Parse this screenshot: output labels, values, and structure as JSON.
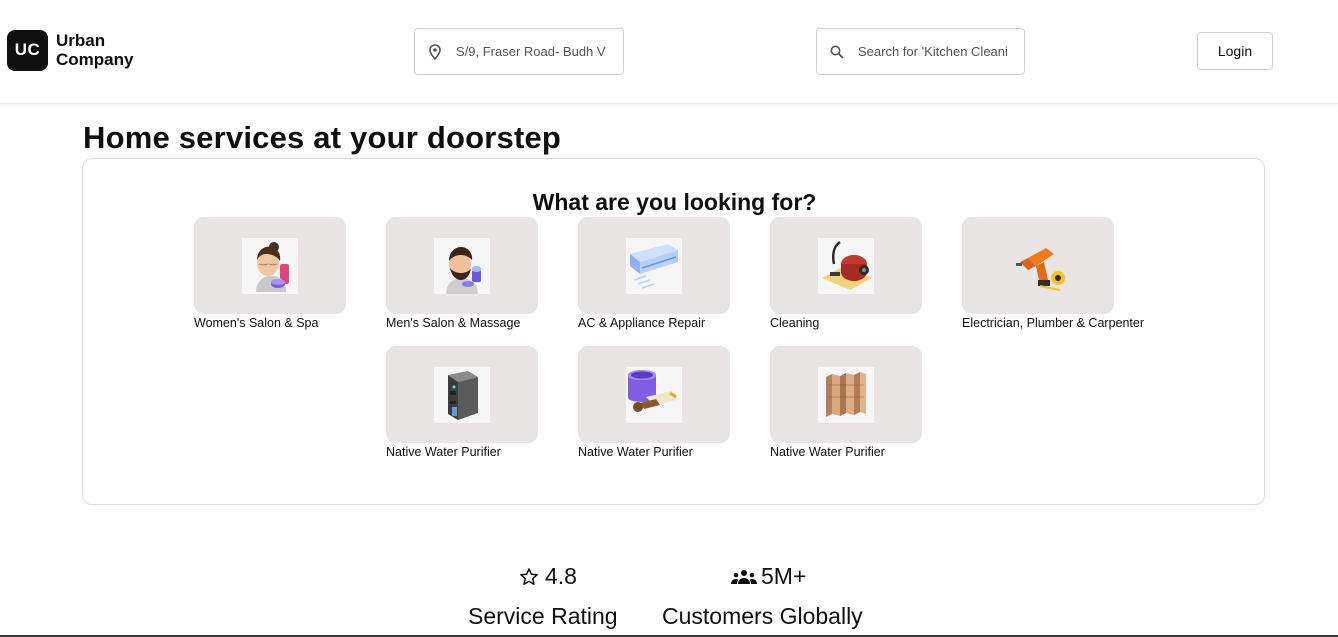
{
  "brand": {
    "mark": "UC",
    "line1": "Urban",
    "line2": "Company"
  },
  "header": {
    "location_value": "S/9, Fraser Road- Budh V",
    "search_placeholder": "Search for 'Kitchen Cleani",
    "login_label": "Login"
  },
  "main": {
    "title": "Home services at your doorstep",
    "panel_title": "What are you looking for?",
    "categories": [
      {
        "label": "Women's Salon & Spa",
        "icon": "woman-facial-icon"
      },
      {
        "label": "Men's Salon & Massage",
        "icon": "man-grooming-icon"
      },
      {
        "label": "AC & Appliance Repair",
        "icon": "air-conditioner-icon"
      },
      {
        "label": "Cleaning",
        "icon": "vacuum-cleaner-icon"
      },
      {
        "label": "Electrician, Plumber & Carpenter",
        "icon": "drill-icon"
      },
      {
        "label": "Native Water Purifier",
        "icon": "water-purifier-icon"
      },
      {
        "label": "Native Water Purifier",
        "icon": "paint-roller-icon"
      },
      {
        "label": "Native Water Purifier",
        "icon": "wood-panels-icon"
      }
    ]
  },
  "stats": [
    {
      "value": "4.8",
      "label": "Service Rating",
      "icon": "star-icon"
    },
    {
      "value": "5M+",
      "label": "Customers Globally",
      "icon": "people-icon"
    }
  ],
  "colors": {
    "tile_bg": "#e8e5e4",
    "text": "#0f0f0f",
    "border": "#cfcfcf"
  }
}
